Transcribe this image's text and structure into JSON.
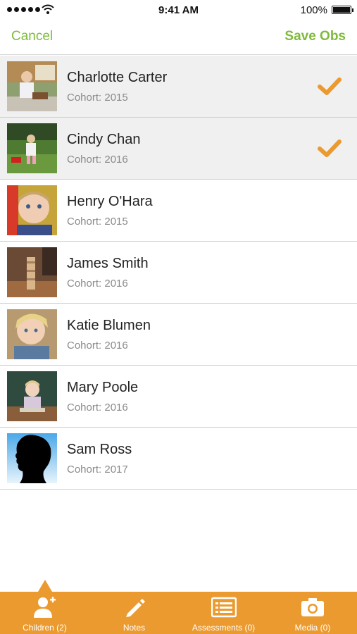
{
  "status_bar": {
    "time": "9:41 AM",
    "battery": "100%"
  },
  "nav": {
    "cancel_label": "Cancel",
    "save_label": "Save Obs"
  },
  "children": [
    {
      "name": "Charlotte Carter",
      "cohort": "Cohort: 2015",
      "selected": true
    },
    {
      "name": "Cindy Chan",
      "cohort": "Cohort: 2016",
      "selected": true
    },
    {
      "name": "Henry O'Hara",
      "cohort": "Cohort: 2015",
      "selected": false
    },
    {
      "name": "James Smith",
      "cohort": "Cohort: 2016",
      "selected": false
    },
    {
      "name": "Katie Blumen",
      "cohort": "Cohort: 2016",
      "selected": false
    },
    {
      "name": "Mary Poole",
      "cohort": "Cohort: 2016",
      "selected": false
    },
    {
      "name": "Sam Ross",
      "cohort": "Cohort: 2017",
      "selected": false
    }
  ],
  "tabs": [
    {
      "label": "Children (2)",
      "icon": "add-child-icon",
      "active": true
    },
    {
      "label": "Notes",
      "icon": "pencil-icon",
      "active": false
    },
    {
      "label": "Assessments (0)",
      "icon": "assessment-list-icon",
      "active": false
    },
    {
      "label": "Media (0)",
      "icon": "camera-icon",
      "active": false
    }
  ],
  "colors": {
    "accent_green": "#7dbb3a",
    "check_orange": "#eb9a2f",
    "tab_bar": "#eb9a2f"
  }
}
